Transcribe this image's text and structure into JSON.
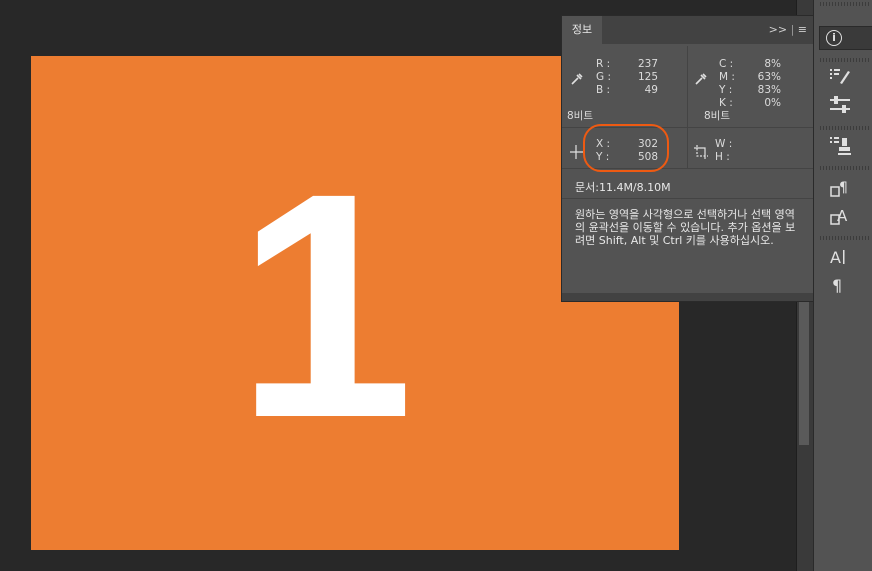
{
  "canvas": {
    "color": "#ed7d31",
    "label": "1"
  },
  "info_panel": {
    "tab_label": "정보",
    "expand_icon": "double-chevron-right-icon",
    "menu_icon": "hamburger-menu-icon",
    "rgb": {
      "r_label": "R :",
      "r_value": "237",
      "g_label": "G :",
      "g_value": "125",
      "b_label": "B :",
      "b_value": "49",
      "bit_label": "8비트"
    },
    "cmyk": {
      "c_label": "C :",
      "c_value": "8%",
      "m_label": "M :",
      "m_value": "63%",
      "y_label": "Y :",
      "y_value": "83%",
      "k_label": "K :",
      "k_value": "0%",
      "bit_label": "8비트"
    },
    "position": {
      "x_label": "X :",
      "x_value": "302",
      "y_label": "Y :",
      "y_value": "508"
    },
    "size": {
      "w_label": "W :",
      "w_value": "",
      "h_label": "H :",
      "h_value": ""
    },
    "doc_size": "문서:11.4M/8.10M",
    "description": "원하는 영역을 사각형으로 선택하거나 선택 영역의 윤곽선을 이동할 수 있습니다. 추가 옵션을 보려면 Shift, Alt 및 Ctrl 키를 사용하십시오.",
    "highlight_color": "#ee5a12"
  },
  "toolstrip": {
    "info_icon": "info-icon",
    "items": [
      "brush-settings-icon",
      "sliders-icon",
      "clone-source-icon",
      "paragraph-style-icon",
      "character-style-icon",
      "character-icon",
      "paragraph-icon"
    ]
  }
}
